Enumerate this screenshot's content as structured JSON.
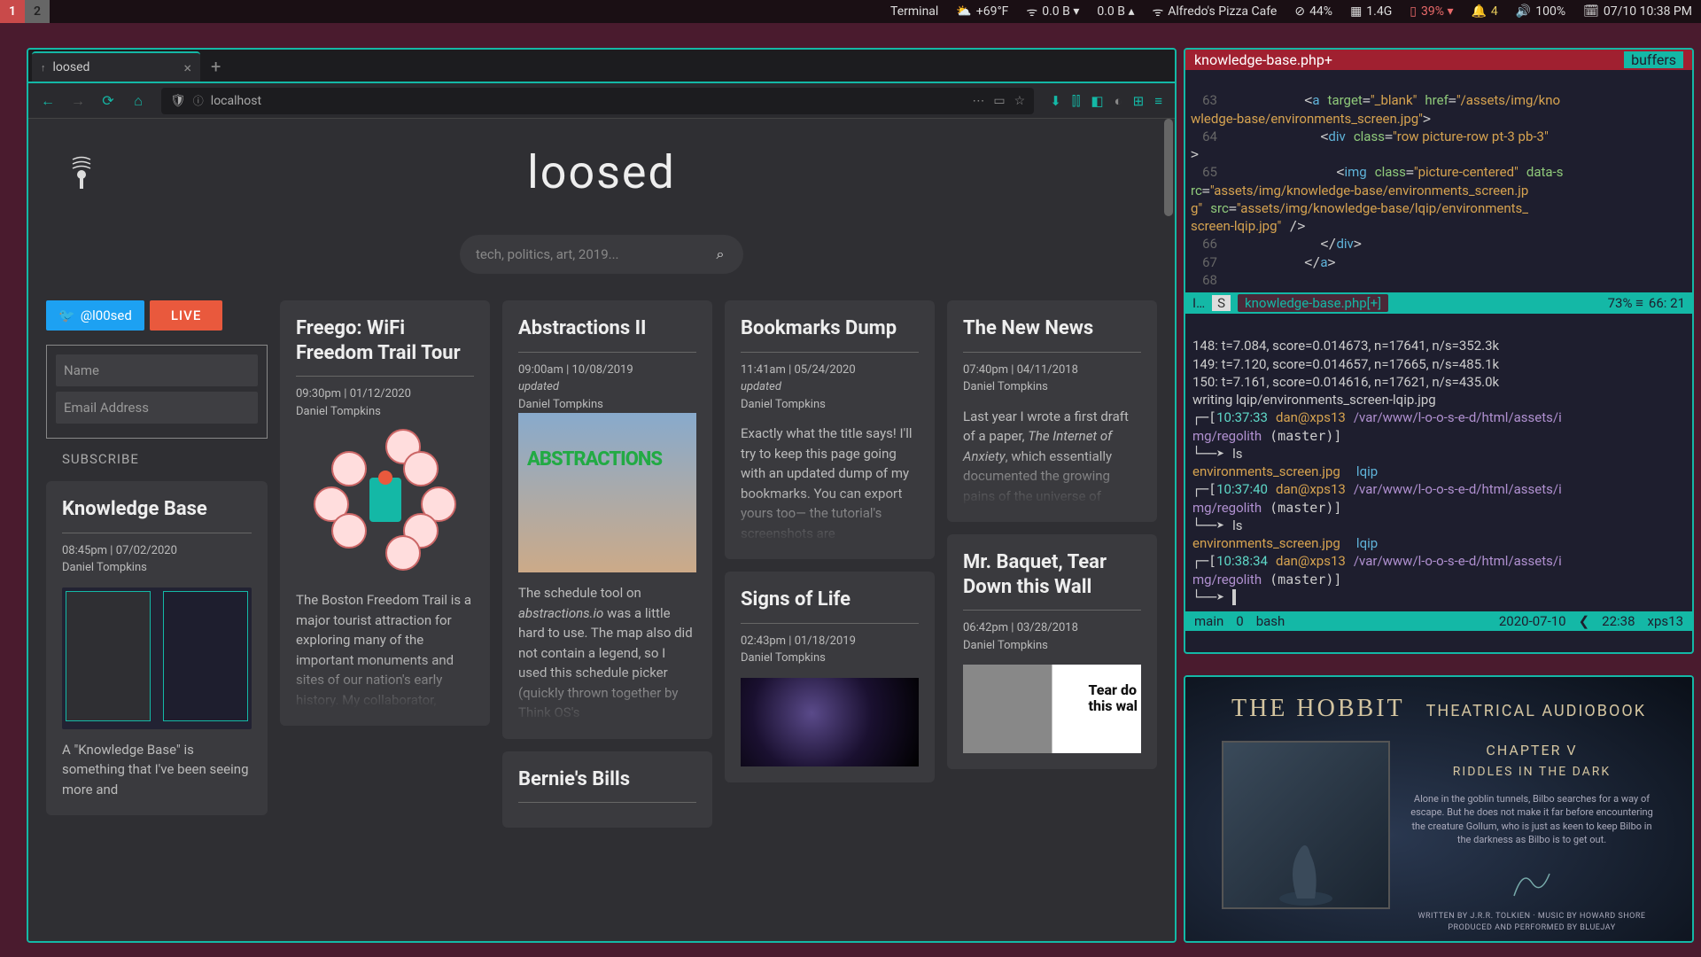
{
  "topbar": {
    "workspaces": [
      "1",
      "2"
    ],
    "active_ws": 0,
    "app": "Terminal",
    "weather": "+69°F",
    "net_down": "0.0 B ▾",
    "net_up": "0.0 B ▴",
    "wifi": "Alfredo's Pizza Cafe",
    "disk": "44%",
    "ram": "1.4G",
    "battery": "39% ▾",
    "notif": "4",
    "volume": "100%",
    "datetime": "07/10 10:38 PM"
  },
  "browser": {
    "tab_label": "loosed",
    "url": "localhost",
    "site_title": "loosed",
    "search_placeholder": "tech, politics, art, 2019...",
    "twitter": "@l00sed",
    "live": "LIVE",
    "name_placeholder": "Name",
    "email_placeholder": "Email Address",
    "subscribe": "SUBSCRIBE"
  },
  "cards": {
    "kb": {
      "title": "Knowledge Base",
      "meta1": "08:45pm | 07/02/2020",
      "author": "Daniel Tompkins",
      "body": "A \"Knowledge Base\" is something that I've been seeing more and"
    },
    "freego": {
      "title": "Freego: WiFi Freedom Trail Tour",
      "meta1": "09:30pm | 01/12/2020",
      "author": "Daniel Tompkins",
      "body": "The Boston Freedom Trail is a major tourist attraction for exploring many of the important monuments and sites of our nation's early history. My collaborator,"
    },
    "abstr": {
      "title": "Abstractions II",
      "meta1": "09:00am | 10/08/2019",
      "updated": "updated",
      "author": "Daniel Tompkins",
      "body1": "The schedule tool on ",
      "ital": "abstractions.io",
      "body2": " was a little hard to use. The map also did not contain a legend, so I used this schedule picker (quickly thrown together by Think OS's"
    },
    "bookmarks": {
      "title": "Bookmarks Dump",
      "meta1": "11:41am | 05/24/2020",
      "updated": "updated",
      "author": "Daniel Tompkins",
      "body": "Exactly what the title says! I'll try to keep this page going with an updated dump of my bookmarks. You can export yours too— the tutorial's screenshots are"
    },
    "signs": {
      "title": "Signs of Life",
      "meta1": "02:43pm | 01/18/2019",
      "author": "Daniel Tompkins"
    },
    "bernie": {
      "title": "Bernie's Bills"
    },
    "newnews": {
      "title": "The New News",
      "meta1": "07:40pm | 04/11/2018",
      "author": "Daniel Tompkins",
      "body1": "Last year I wrote a first draft of a paper, ",
      "ital": "The Internet of Anxiety",
      "body2": ", which essentially documented the growing pains of the universe of"
    },
    "baquet": {
      "title": "Mr. Baquet, Tear Down this Wall",
      "meta1": "06:42pm | 03/28/2018",
      "author": "Daniel Tompkins",
      "img_txt": "Tear do\nthis wal"
    }
  },
  "editor": {
    "filename": "knowledge-base.php+",
    "buffers": "buffers",
    "lines": {
      "63": "          <a target=\"_blank\" href=\"/assets/img/knowledge-base/environments_screen.jpg\">",
      "64": "            <div class=\"row picture-row pt-3 pb-3\">",
      "65": "              <img class=\"picture-centered\" data-src=\"assets/img/knowledge-base/environments_screen.jpg\" src=\"assets/img/knowledge-base/lqip/environments_screen-lqip.jpg\" />",
      "66": "            </div>",
      "67": "          </a>",
      "68": ""
    },
    "status_mode": "I…",
    "status_s": "S",
    "status_file": "knowledge-base.php[+]",
    "status_pct": "73% ≡",
    "status_pos": "66: 21"
  },
  "terminal": {
    "lines": [
      "148: t=7.084, score=0.014673, n=17641, n/s=352.3k",
      "149: t=7.120, score=0.014657, n=17665, n/s=485.1k",
      "150: t=7.161, score=0.014616, n=17621, n/s=435.0k",
      "writing lqip/environments_screen-lqip.jpg"
    ],
    "p1_time": "10:37:33",
    "p1_user": "dan@xps13",
    "p1_path": "/var/www/l-o-o-s-e-d/html/assets/img/regolith (master)",
    "ls": "ls",
    "files": "environments_screen.jpg  lqip",
    "p2_time": "10:37:40",
    "p3_time": "10:38:34",
    "status_main": "main",
    "status_n": "0",
    "status_sh": "bash",
    "status_date": "2020-07-10",
    "status_time": "22:38",
    "status_host": "xps13"
  },
  "video": {
    "title": "THE HOBBIT",
    "subtitle": "THEATRICAL AUDIOBOOK",
    "chapter": "CHAPTER V",
    "chapname": "RIDDLES IN THE DARK",
    "blurb": "Alone in the goblin tunnels, Bilbo searches for a way of escape. But he does not make it far before encountering the creature Gollum, who is just as keen to keep Bilbo in the darkness as Bilbo is to get out.",
    "credits": "WRITTEN BY J.R.R. TOLKIEN · MUSIC BY HOWARD SHORE\nPRODUCED AND PERFORMED BY BLUEJAY"
  }
}
